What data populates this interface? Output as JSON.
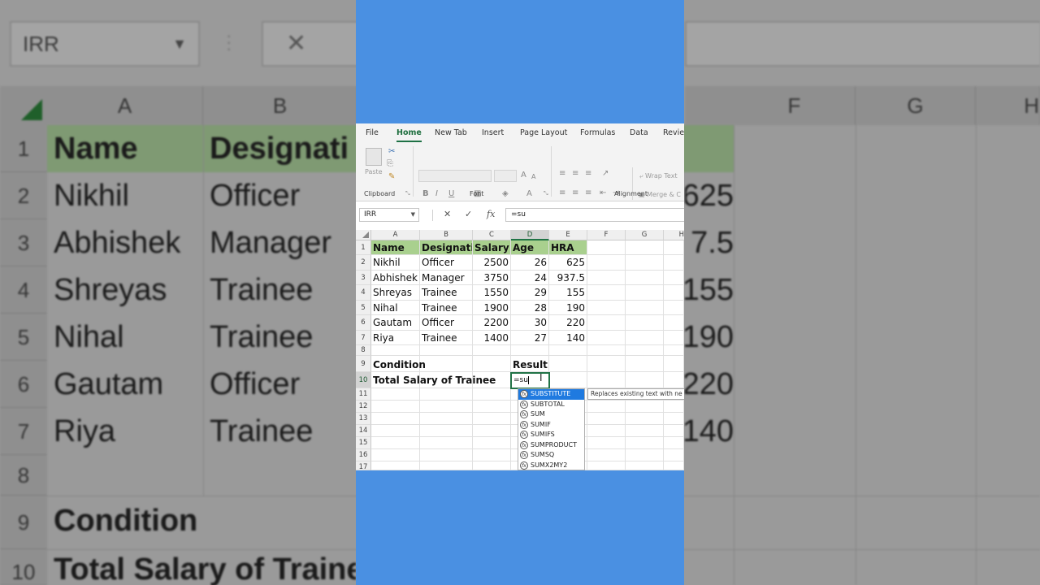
{
  "app": {
    "ribbon_tabs": [
      "File",
      "Home",
      "New Tab",
      "Insert",
      "Page Layout",
      "Formulas",
      "Data",
      "Review"
    ],
    "active_tab": "Home",
    "groups": {
      "clipboard": "Clipboard",
      "font": "Font",
      "alignment": "Alignment"
    },
    "paste_label": "Paste",
    "wrap_text_label": "Wrap Text",
    "merge_label": "Merge & C"
  },
  "formula_bar": {
    "name_box": "IRR",
    "formula": "=su",
    "cancel_icon": "✕",
    "enter_icon": "✓",
    "fx_icon": "fx"
  },
  "columns": [
    "A",
    "B",
    "C",
    "D",
    "E",
    "F",
    "G",
    "H"
  ],
  "selected_column": "D",
  "rows": [
    "1",
    "2",
    "3",
    "4",
    "5",
    "6",
    "7",
    "8",
    "9",
    "10",
    "11",
    "12",
    "13",
    "14",
    "15",
    "16",
    "17"
  ],
  "selected_row": "10",
  "table": {
    "headers": [
      "Name",
      "Designatio",
      "Salary",
      "Age",
      "HRA"
    ],
    "data": [
      [
        "Nikhil",
        "Officer",
        "2500",
        "26",
        "625"
      ],
      [
        "Abhishek",
        "Manager",
        "3750",
        "24",
        "937.5"
      ],
      [
        "Shreyas",
        "Trainee",
        "1550",
        "29",
        "155"
      ],
      [
        "Nihal",
        "Trainee",
        "1900",
        "28",
        "190"
      ],
      [
        "Gautam",
        "Officer",
        "2200",
        "30",
        "220"
      ],
      [
        "Riya",
        "Trainee",
        "1400",
        "27",
        "140"
      ]
    ]
  },
  "condition_label": "Condition",
  "result_label": "Result",
  "total_label": "Total Salary of Trainee",
  "active_cell_text": "=su",
  "autocomplete": {
    "items": [
      "SUBSTITUTE",
      "SUBTOTAL",
      "SUM",
      "SUMIF",
      "SUMIFS",
      "SUMPRODUCT",
      "SUMSQ",
      "SUMX2MY2"
    ],
    "selected": "SUBSTITUTE",
    "tooltip": "Replaces existing text with ne"
  },
  "background": {
    "name_box": "IRR",
    "cancel_icon": "✕",
    "col_letters": [
      "A",
      "B",
      "F",
      "G",
      "H"
    ],
    "row_numbers": [
      "1",
      "2",
      "3",
      "4",
      "5",
      "6",
      "7",
      "8",
      "9",
      "10"
    ],
    "col_a": [
      "Name",
      "Nikhil",
      "Abhishek",
      "Shreyas",
      "Nihal",
      "Gautam",
      "Riya",
      "",
      "Condition",
      "Total Salary of Traine"
    ],
    "col_b": [
      "Designati",
      "Officer",
      "Manager",
      "Trainee",
      "Trainee",
      "Officer",
      "Trainee"
    ],
    "right_values": [
      "625",
      "7.5",
      "155",
      "190",
      "220",
      "140"
    ]
  },
  "colors": {
    "header_fill": "#a9d08e",
    "excel_green": "#217346",
    "blue_side": "#4a90e2",
    "autocomplete_select": "#1f7ae0"
  }
}
